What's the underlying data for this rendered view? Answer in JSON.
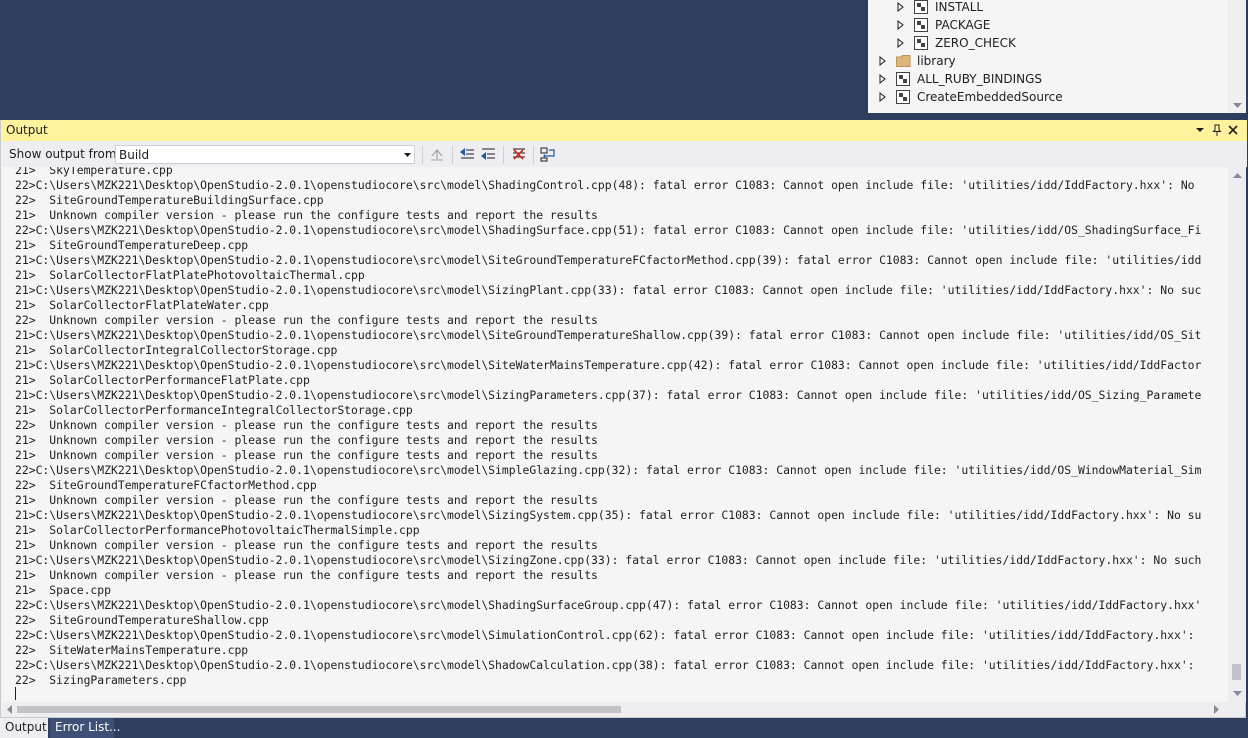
{
  "solution_explorer": {
    "items": [
      {
        "label": "INSTALL",
        "icon": "cmake-target-icon"
      },
      {
        "label": "PACKAGE",
        "icon": "cmake-target-icon"
      },
      {
        "label": "ZERO_CHECK",
        "icon": "cmake-target-icon"
      },
      {
        "label": "library",
        "icon": "folder-icon"
      },
      {
        "label": "ALL_RUBY_BINDINGS",
        "icon": "cmake-target-icon"
      },
      {
        "label": "CreateEmbeddedSource",
        "icon": "cmake-target-icon"
      }
    ]
  },
  "output": {
    "title": "Output",
    "show_output_from_label": "Show output from:",
    "source_selected": "Build",
    "lines": [
      "21>  SkyTemperature.cpp",
      "22>C:\\Users\\MZK221\\Desktop\\OpenStudio-2.0.1\\openstudiocore\\src\\model\\ShadingControl.cpp(48): fatal error C1083: Cannot open include file: 'utilities/idd/IddFactory.hxx': No",
      "22>  SiteGroundTemperatureBuildingSurface.cpp",
      "21>  Unknown compiler version - please run the configure tests and report the results",
      "22>C:\\Users\\MZK221\\Desktop\\OpenStudio-2.0.1\\openstudiocore\\src\\model\\ShadingSurface.cpp(51): fatal error C1083: Cannot open include file: 'utilities/idd/OS_ShadingSurface_Fi",
      "21>  SiteGroundTemperatureDeep.cpp",
      "21>C:\\Users\\MZK221\\Desktop\\OpenStudio-2.0.1\\openstudiocore\\src\\model\\SiteGroundTemperatureFCfactorMethod.cpp(39): fatal error C1083: Cannot open include file: 'utilities/idd",
      "21>  SolarCollectorFlatPlatePhotovoltaicThermal.cpp",
      "21>C:\\Users\\MZK221\\Desktop\\OpenStudio-2.0.1\\openstudiocore\\src\\model\\SizingPlant.cpp(33): fatal error C1083: Cannot open include file: 'utilities/idd/IddFactory.hxx': No suc",
      "21>  SolarCollectorFlatPlateWater.cpp",
      "22>  Unknown compiler version - please run the configure tests and report the results",
      "21>C:\\Users\\MZK221\\Desktop\\OpenStudio-2.0.1\\openstudiocore\\src\\model\\SiteGroundTemperatureShallow.cpp(39): fatal error C1083: Cannot open include file: 'utilities/idd/OS_Sit",
      "21>  SolarCollectorIntegralCollectorStorage.cpp",
      "21>C:\\Users\\MZK221\\Desktop\\OpenStudio-2.0.1\\openstudiocore\\src\\model\\SiteWaterMainsTemperature.cpp(42): fatal error C1083: Cannot open include file: 'utilities/idd/IddFactor",
      "21>  SolarCollectorPerformanceFlatPlate.cpp",
      "21>C:\\Users\\MZK221\\Desktop\\OpenStudio-2.0.1\\openstudiocore\\src\\model\\SizingParameters.cpp(37): fatal error C1083: Cannot open include file: 'utilities/idd/OS_Sizing_Paramete",
      "21>  SolarCollectorPerformanceIntegralCollectorStorage.cpp",
      "22>  Unknown compiler version - please run the configure tests and report the results",
      "21>  Unknown compiler version - please run the configure tests and report the results",
      "21>  Unknown compiler version - please run the configure tests and report the results",
      "22>C:\\Users\\MZK221\\Desktop\\OpenStudio-2.0.1\\openstudiocore\\src\\model\\SimpleGlazing.cpp(32): fatal error C1083: Cannot open include file: 'utilities/idd/OS_WindowMaterial_Sim",
      "22>  SiteGroundTemperatureFCfactorMethod.cpp",
      "21>  Unknown compiler version - please run the configure tests and report the results",
      "21>C:\\Users\\MZK221\\Desktop\\OpenStudio-2.0.1\\openstudiocore\\src\\model\\SizingSystem.cpp(35): fatal error C1083: Cannot open include file: 'utilities/idd/IddFactory.hxx': No su",
      "21>  SolarCollectorPerformancePhotovoltaicThermalSimple.cpp",
      "21>  Unknown compiler version - please run the configure tests and report the results",
      "21>C:\\Users\\MZK221\\Desktop\\OpenStudio-2.0.1\\openstudiocore\\src\\model\\SizingZone.cpp(33): fatal error C1083: Cannot open include file: 'utilities/idd/IddFactory.hxx': No such",
      "21>  Unknown compiler version - please run the configure tests and report the results",
      "21>  Space.cpp",
      "22>C:\\Users\\MZK221\\Desktop\\OpenStudio-2.0.1\\openstudiocore\\src\\model\\ShadingSurfaceGroup.cpp(47): fatal error C1083: Cannot open include file: 'utilities/idd/IddFactory.hxx'",
      "22>  SiteGroundTemperatureShallow.cpp",
      "22>C:\\Users\\MZK221\\Desktop\\OpenStudio-2.0.1\\openstudiocore\\src\\model\\SimulationControl.cpp(62): fatal error C1083: Cannot open include file: 'utilities/idd/IddFactory.hxx':",
      "22>  SiteWaterMainsTemperature.cpp",
      "22>C:\\Users\\MZK221\\Desktop\\OpenStudio-2.0.1\\openstudiocore\\src\\model\\ShadowCalculation.cpp(38): fatal error C1083: Cannot open include file: 'utilities/idd/IddFactory.hxx':",
      "22>  SizingParameters.cpp"
    ]
  },
  "bottom_tabs": [
    {
      "label": "Output",
      "active": true
    },
    {
      "label": "Error List..."
    }
  ],
  "colors": {
    "title_bar_active": "#fff29d",
    "shell_background": "#2f3e5f",
    "panel_background": "#eeeef2",
    "text_background": "#f5f5f5"
  }
}
